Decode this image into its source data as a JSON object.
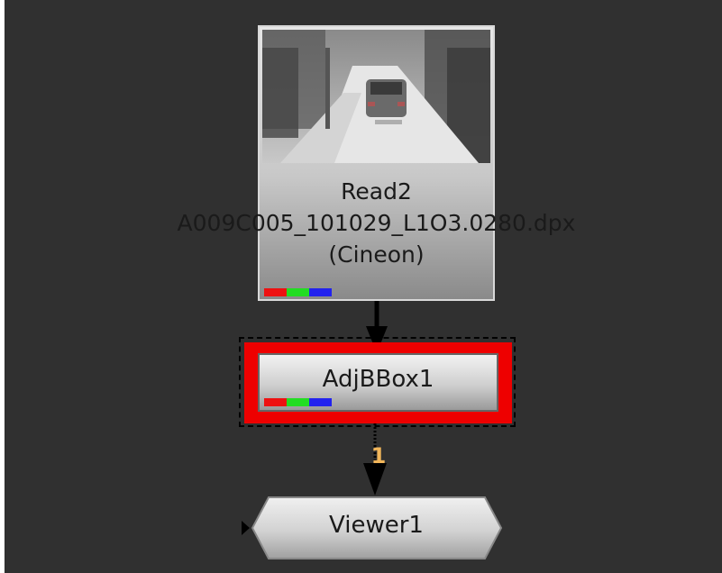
{
  "colors": {
    "canvas_background": "#303030",
    "selection_highlight": "#ee0000",
    "input_number": "#f2b65a",
    "channel_red": "#ee1111",
    "channel_green": "#22dd22",
    "channel_blue": "#2222ee"
  },
  "nodes": {
    "read": {
      "name": "Read2",
      "file": "A009C005_101029_L1O3.0280.dpx",
      "colorspace": "(Cineon)",
      "thumbnail": "snowy-road-car-thumbnail"
    },
    "adjbbox": {
      "name": "AdjBBox1",
      "selected": true
    },
    "viewer": {
      "name": "Viewer1"
    }
  },
  "connections": {
    "viewer_input_label": "1"
  },
  "channels": [
    "red",
    "green",
    "blue"
  ]
}
